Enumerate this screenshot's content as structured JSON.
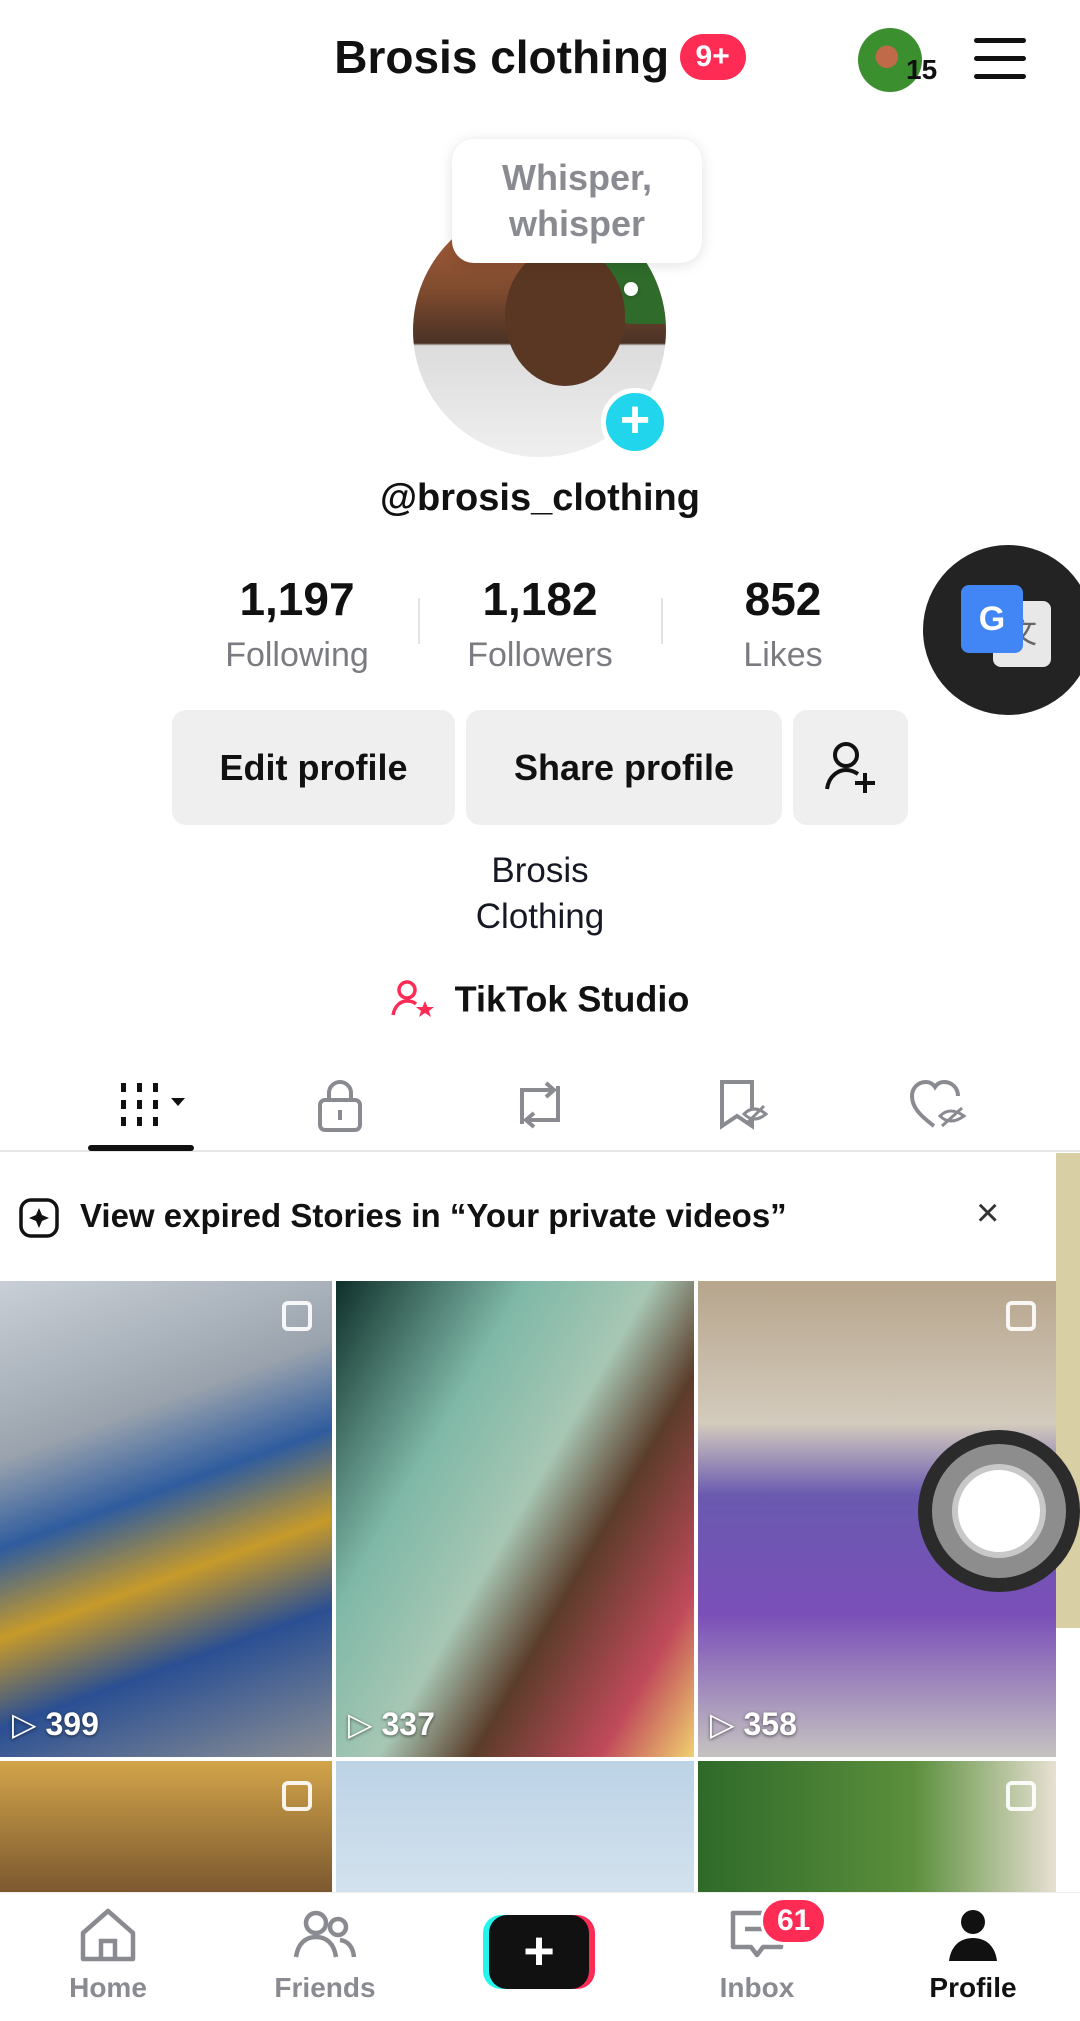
{
  "header": {
    "title": "Brosis clothing",
    "notif_badge": "9+",
    "avatar_count": "15"
  },
  "profile": {
    "bubble_text": "Whisper, whisper",
    "username": "@brosis_clothing",
    "stats": [
      {
        "value": "1,197",
        "label": "Following"
      },
      {
        "value": "1,182",
        "label": "Followers"
      },
      {
        "value": "852",
        "label": "Likes"
      }
    ],
    "buttons": {
      "edit": "Edit profile",
      "share": "Share profile"
    },
    "bio_line1": "Brosis",
    "bio_line2": "Clothing",
    "studio": "TikTok Studio"
  },
  "banner": {
    "text": "View expired Stories in “Your private videos”",
    "close": "×"
  },
  "videos": [
    {
      "views": "399"
    },
    {
      "views": "337"
    },
    {
      "views": "358"
    }
  ],
  "nav": {
    "home": "Home",
    "friends": "Friends",
    "inbox": "Inbox",
    "inbox_badge": "61",
    "profile": "Profile"
  },
  "colors": {
    "accent": "#fe2c55",
    "teal": "#20d5ec",
    "gray_btn": "#efefef"
  }
}
